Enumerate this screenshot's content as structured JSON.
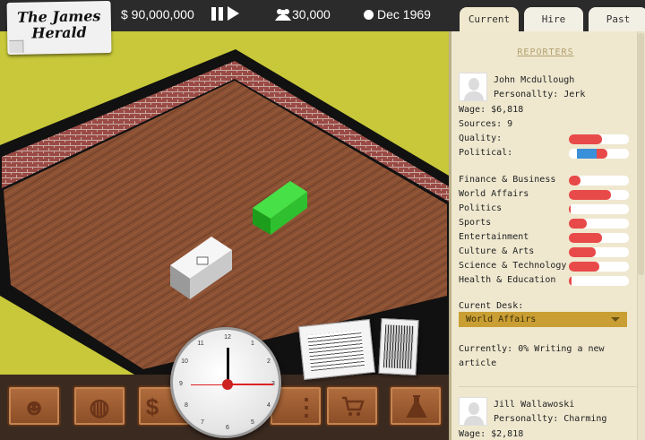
{
  "topbar": {
    "logo_text": "The James Herald",
    "money": "$ 90,000,000",
    "readers": "30,000",
    "date": "Dec 1969"
  },
  "tabs": [
    {
      "label": "Current",
      "active": true
    },
    {
      "label": "Hire",
      "active": false
    },
    {
      "label": "Past",
      "active": false
    }
  ],
  "panel": {
    "section_title": "REPORTERS",
    "reporters": [
      {
        "name": "John Mcdullough",
        "personality": "Personallty: Jerk",
        "wage": "Wage: $6,818",
        "sources": "Sources: 9",
        "quality_label": "Quality:",
        "quality": 0.55,
        "political_label": "Political:",
        "political": 0.45,
        "skills": [
          {
            "label": "Finance & Business",
            "value": 0.2
          },
          {
            "label": "World Affairs",
            "value": 0.7
          },
          {
            "label": "Politics",
            "value": 0.03
          },
          {
            "label": "Sports",
            "value": 0.3
          },
          {
            "label": "Entertainment",
            "value": 0.55
          },
          {
            "label": "Culture & Arts",
            "value": 0.45
          },
          {
            "label": "Science & Technology",
            "value": 0.5
          },
          {
            "label": "Health & Education",
            "value": 0.04
          }
        ],
        "desk_label": "Curent Desk:",
        "desk_value": "World Affairs",
        "status": "Currently: 0% Writing a new",
        "status2": "article"
      },
      {
        "name": "Jill Wallawoski",
        "personality": "Personallty: Charming",
        "wage": "Wage: $2,818"
      }
    ]
  },
  "colors": {
    "bar_fill": "#e84a4a",
    "political_blue": "#3a8fd9",
    "desk_select": "#c99e33",
    "panel_bg": "#efe8cf",
    "background": "#c8c83a"
  },
  "toolbar": {
    "buttons": [
      {
        "icon": "reporter-icon"
      },
      {
        "icon": "globe-icon"
      },
      {
        "icon": "money-icon"
      },
      {
        "icon": "menu-icon"
      },
      {
        "icon": "cart-icon"
      },
      {
        "icon": "flask-icon"
      }
    ],
    "money_glyph": "$",
    "menu_glyph": "⋮",
    "cart_glyph": "🛒",
    "flask_glyph": "⚗",
    "reporter_glyph": "☻",
    "globe_glyph": "◍"
  },
  "clock": {
    "time": "15:00"
  }
}
